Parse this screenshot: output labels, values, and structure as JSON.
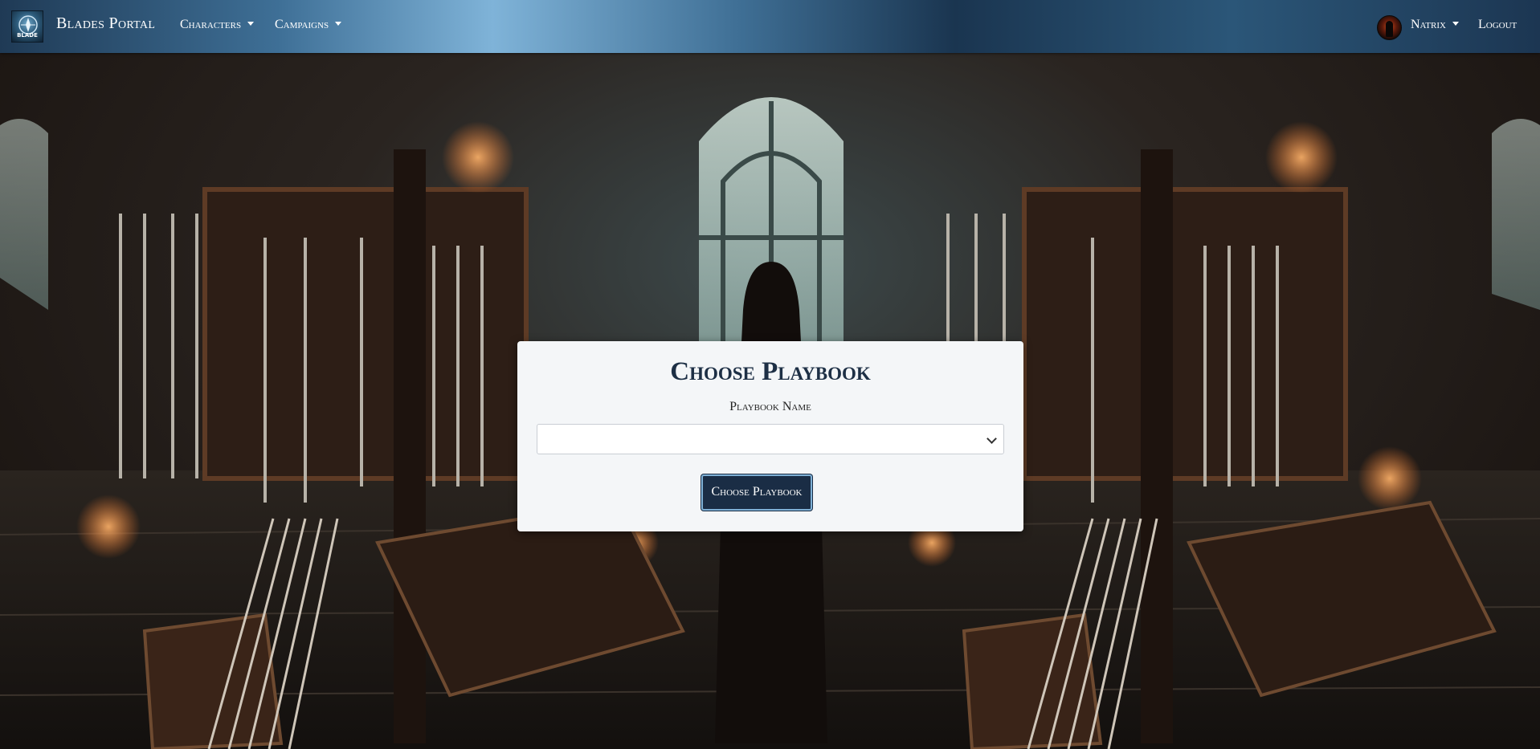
{
  "navbar": {
    "logo_text": "BLADE",
    "brand": "Blades Portal",
    "menu": [
      {
        "label": "Characters"
      },
      {
        "label": "Campaigns"
      }
    ],
    "user": {
      "name": "Natrix"
    },
    "logout_label": "Logout"
  },
  "background": {
    "description_icon": "armory-scene"
  },
  "form": {
    "title": "Choose Playbook",
    "field_label": "Playbook Name",
    "select_value": "",
    "submit_label": "Choose Playbook"
  },
  "colors": {
    "navbar_accent": "#7fb3d8",
    "navbar_dark": "#1a3550",
    "button_bg": "#1a2d45",
    "button_border": "#7eb0d6",
    "card_bg": "#f4f6f8",
    "title_color": "#1d2f45"
  }
}
